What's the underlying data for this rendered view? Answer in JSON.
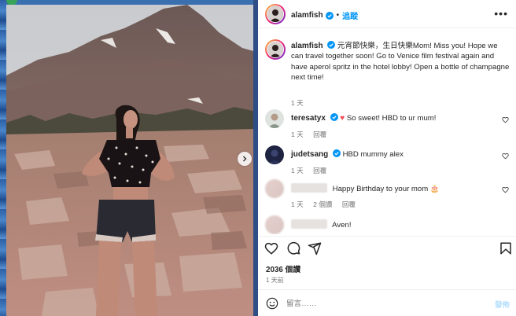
{
  "post": {
    "author": "alamfish",
    "separator": "•",
    "follow_label": "追蹤",
    "more_label": "•••",
    "caption": "元宵節快樂，生日快樂Mom! Miss you! Hope we can travel together soon! Go to Venice film festival again and have aperol spritz in the hotel lobby! Open a bottle of champagne next time!",
    "caption_time": "1 天"
  },
  "comments": [
    {
      "user": "teresatyx",
      "verified": true,
      "text": " So sweet! HBD to ur mum!",
      "heart_emoji": "♥",
      "time": "1 天",
      "likes": "",
      "reply": "回覆"
    },
    {
      "user": "judetsang",
      "verified": true,
      "text": "HBD mummy alex",
      "time": "1 天",
      "likes": "",
      "reply": "回覆"
    },
    {
      "user": "",
      "verified": false,
      "text": "Happy Birthday to your mom 🎂",
      "time": "1 天",
      "likes": "2 個讚",
      "reply": "回覆"
    },
    {
      "user": "",
      "verified": false,
      "text": "Aven!",
      "time": "",
      "likes": "",
      "reply": ""
    }
  ],
  "stats": {
    "likes": "2036 個讚",
    "post_time": "1 天前"
  },
  "composer": {
    "placeholder": "留言……",
    "post_label": "發佈"
  },
  "icons": [
    "verified-badge-icon",
    "heart-icon",
    "comment-icon",
    "share-icon",
    "bookmark-icon",
    "emoji-icon",
    "chevron-right-icon",
    "more-options-icon"
  ],
  "colors": {
    "accent": "#0095f6",
    "post_disabled": "#b2dffc",
    "like_red": "#ed4956",
    "muted_text": "#737373"
  }
}
